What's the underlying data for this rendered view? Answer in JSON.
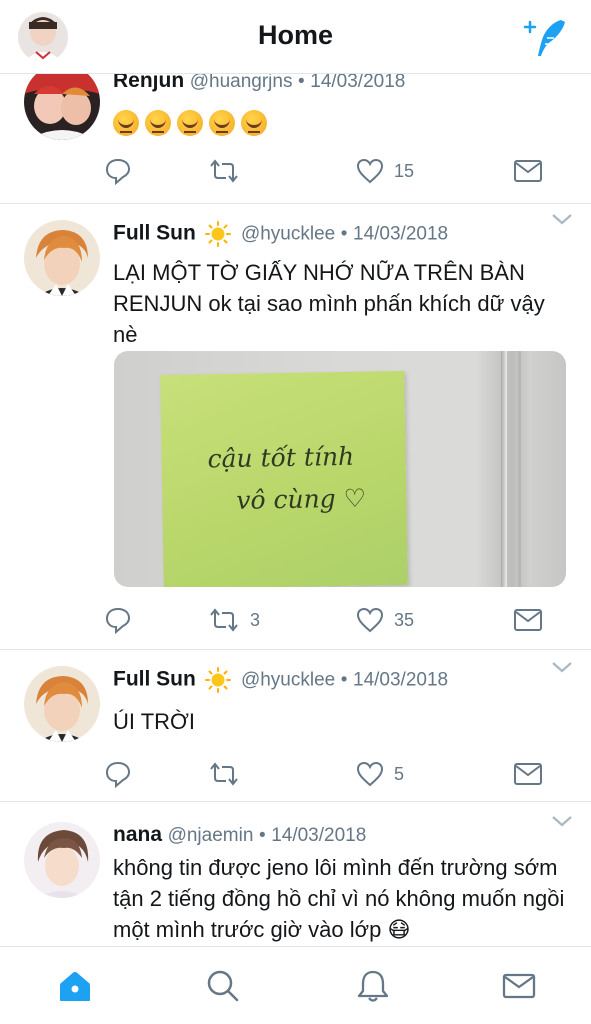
{
  "header": {
    "title": "Home",
    "avatar": "profile-avatar",
    "compose_icon": "compose-feather-icon",
    "accent": "#1da1f2"
  },
  "tweets": [
    {
      "name": "Renjun",
      "handle": "@huangrjns",
      "date": "14/03/2018",
      "text": "",
      "emoji_count": 5,
      "replies": "",
      "retweets": "",
      "likes": "15"
    },
    {
      "name": "Full Sun",
      "handle": "@hyucklee",
      "date": "14/03/2018",
      "text": "LẠI MỘT TỜ GIẤY NHỚ NỮA TRÊN BÀN RENJUN ok tại sao mình phấn khích dữ vậy nè",
      "photo_note_line1": "cậu tốt tính",
      "photo_note_line2": "vô cùng ♡",
      "replies": "",
      "retweets": "3",
      "likes": "35"
    },
    {
      "name": "Full Sun",
      "handle": "@hyucklee",
      "date": "14/03/2018",
      "text": "ÚI TRỜI",
      "replies": "",
      "retweets": "",
      "likes": "5"
    },
    {
      "name": "nana",
      "handle": "@njaemin",
      "date": "14/03/2018",
      "text": "không tin được jeno lôi mình đến trường sớm tận 2 tiếng đồng hồ chỉ vì nó không muốn ngồi một mình trước giờ vào lớp 😷"
    }
  ],
  "separator": "•",
  "tabbar": {
    "items": [
      "home-icon",
      "search-icon",
      "notifications-bell-icon",
      "messages-envelope-icon"
    ],
    "active": "home-icon"
  }
}
